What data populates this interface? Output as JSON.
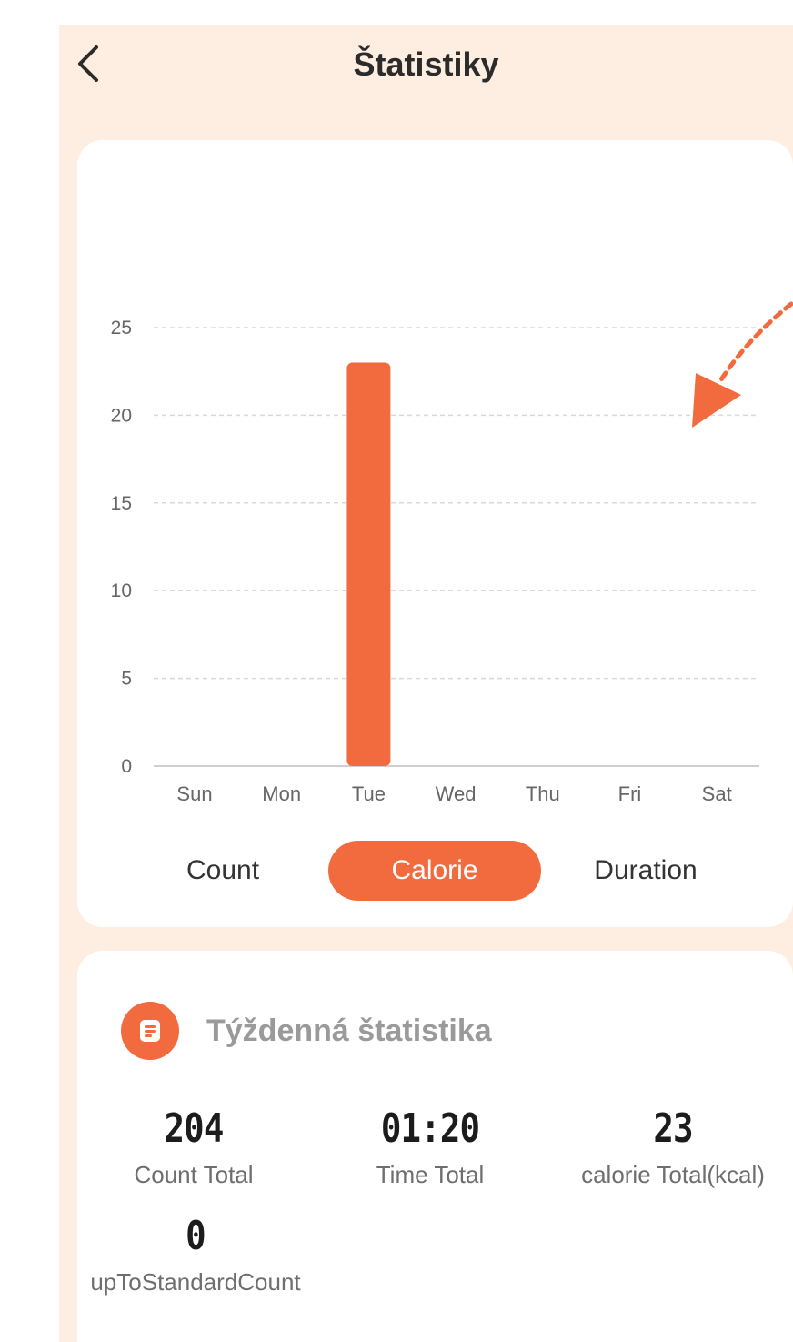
{
  "header": {
    "title": "Štatistiky"
  },
  "chart_data": {
    "type": "bar",
    "categories": [
      "Sun",
      "Mon",
      "Tue",
      "Wed",
      "Thu",
      "Fri",
      "Sat"
    ],
    "values": [
      0,
      0,
      23,
      0,
      0,
      0,
      0
    ],
    "y_ticks": [
      "0",
      "5",
      "10",
      "15",
      "20",
      "25"
    ],
    "ylim": [
      0,
      25
    ],
    "grid": true,
    "bar_color": "#f26b3f"
  },
  "tabs": [
    {
      "label": "Count",
      "active": false
    },
    {
      "label": "Calorie",
      "active": true
    },
    {
      "label": "Duration",
      "active": false
    }
  ],
  "weekly": {
    "title": "Týždenná štatistika",
    "stats": [
      {
        "value": "204",
        "label": "Count Total"
      },
      {
        "value": "01:20",
        "label": "Time Total"
      },
      {
        "value": "23",
        "label": "calorie Total(kcal)"
      },
      {
        "value": "0",
        "label": "upToStandardCount"
      }
    ]
  },
  "colors": {
    "accent": "#f26b3f",
    "background": "#fdeee1"
  },
  "icons": {
    "back": "chevron-left-icon",
    "stats": "document-list-icon",
    "hint": "dotted-arrow-icon"
  }
}
